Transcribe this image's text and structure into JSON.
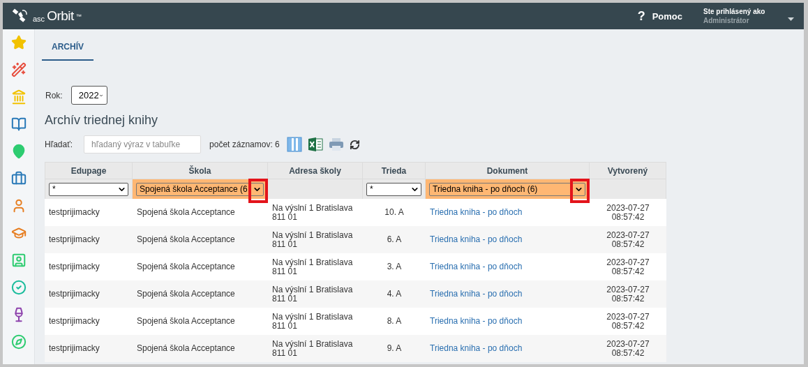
{
  "header": {
    "logo": {
      "small": "asc",
      "main": "Orbit",
      "mark": "™"
    },
    "help": {
      "icon": "?",
      "label": "Pomoc"
    },
    "user": {
      "caption": "Ste prihlásený ako",
      "name": "Administrátor"
    }
  },
  "sidebar": {
    "items": [
      {
        "kind": "star"
      },
      {
        "kind": "wand"
      },
      {
        "kind": "bank"
      },
      {
        "kind": "book"
      },
      {
        "kind": "pin"
      },
      {
        "kind": "briefcase"
      },
      {
        "kind": "person"
      },
      {
        "kind": "graduation"
      },
      {
        "kind": "badge"
      },
      {
        "kind": "check"
      },
      {
        "kind": "dining"
      },
      {
        "kind": "compass"
      }
    ]
  },
  "tabs": [
    {
      "label": "ARCHÍV",
      "selected": true
    }
  ],
  "year": {
    "label": "Rok:",
    "value": "2022"
  },
  "title": "Archív triednej knihy",
  "toolbar": {
    "search_label": "Hľadať:",
    "placeholder": "hľadaný výraz v tabuľke",
    "count": "počet záznamov: 6"
  },
  "table": {
    "columns": [
      {
        "label": "Edupage",
        "filter": {
          "value": "*",
          "active": false,
          "highlighted": false
        }
      },
      {
        "label": "Škola",
        "filter": {
          "value": "Spojená škola Acceptance (6",
          "active": true,
          "highlighted": true
        }
      },
      {
        "label": "Adresa školy"
      },
      {
        "label": "Trieda",
        "filter": {
          "value": "*",
          "active": false,
          "highlighted": false
        }
      },
      {
        "label": "Dokument",
        "filter": {
          "value": "Triedna kniha - po dňoch (6)",
          "active": true,
          "highlighted": true
        }
      },
      {
        "label": "Vytvorený"
      }
    ],
    "rows": [
      {
        "edupage": "testprijimacky",
        "school": "Spojená škola Acceptance",
        "address": [
          "Na výslní 1 Bratislava",
          "811 01"
        ],
        "class": "10. A",
        "document": "Triedna kniha - po dňoch",
        "created": [
          "2023-07-27",
          "08:57:42"
        ]
      },
      {
        "edupage": "testprijimacky",
        "school": "Spojená škola Acceptance",
        "address": [
          "Na výslní 1 Bratislava",
          "811 01"
        ],
        "class": "6. A",
        "document": "Triedna kniha - po dňoch",
        "created": [
          "2023-07-27",
          "08:57:42"
        ]
      },
      {
        "edupage": "testprijimacky",
        "school": "Spojená škola Acceptance",
        "address": [
          "Na výslní 1 Bratislava",
          "811 01"
        ],
        "class": "3. A",
        "document": "Triedna kniha - po dňoch",
        "created": [
          "2023-07-27",
          "08:57:42"
        ]
      },
      {
        "edupage": "testprijimacky",
        "school": "Spojená škola Acceptance",
        "address": [
          "Na výslní 1 Bratislava",
          "811 01"
        ],
        "class": "4. A",
        "document": "Triedna kniha - po dňoch",
        "created": [
          "2023-07-27",
          "08:57:42"
        ]
      },
      {
        "edupage": "testprijimacky",
        "school": "Spojená škola Acceptance",
        "address": [
          "Na výslní 1 Bratislava",
          "811 01"
        ],
        "class": "8. A",
        "document": "Triedna kniha - po dňoch",
        "created": [
          "2023-07-27",
          "08:57:42"
        ]
      },
      {
        "edupage": "testprijimacky",
        "school": "Spojená škola Acceptance",
        "address": [
          "Na výslní 1 Bratislava",
          "811 01"
        ],
        "class": "9. A",
        "document": "Triedna kniha - po dňoch",
        "created": [
          "2023-07-27",
          "08:57:42"
        ]
      }
    ]
  }
}
